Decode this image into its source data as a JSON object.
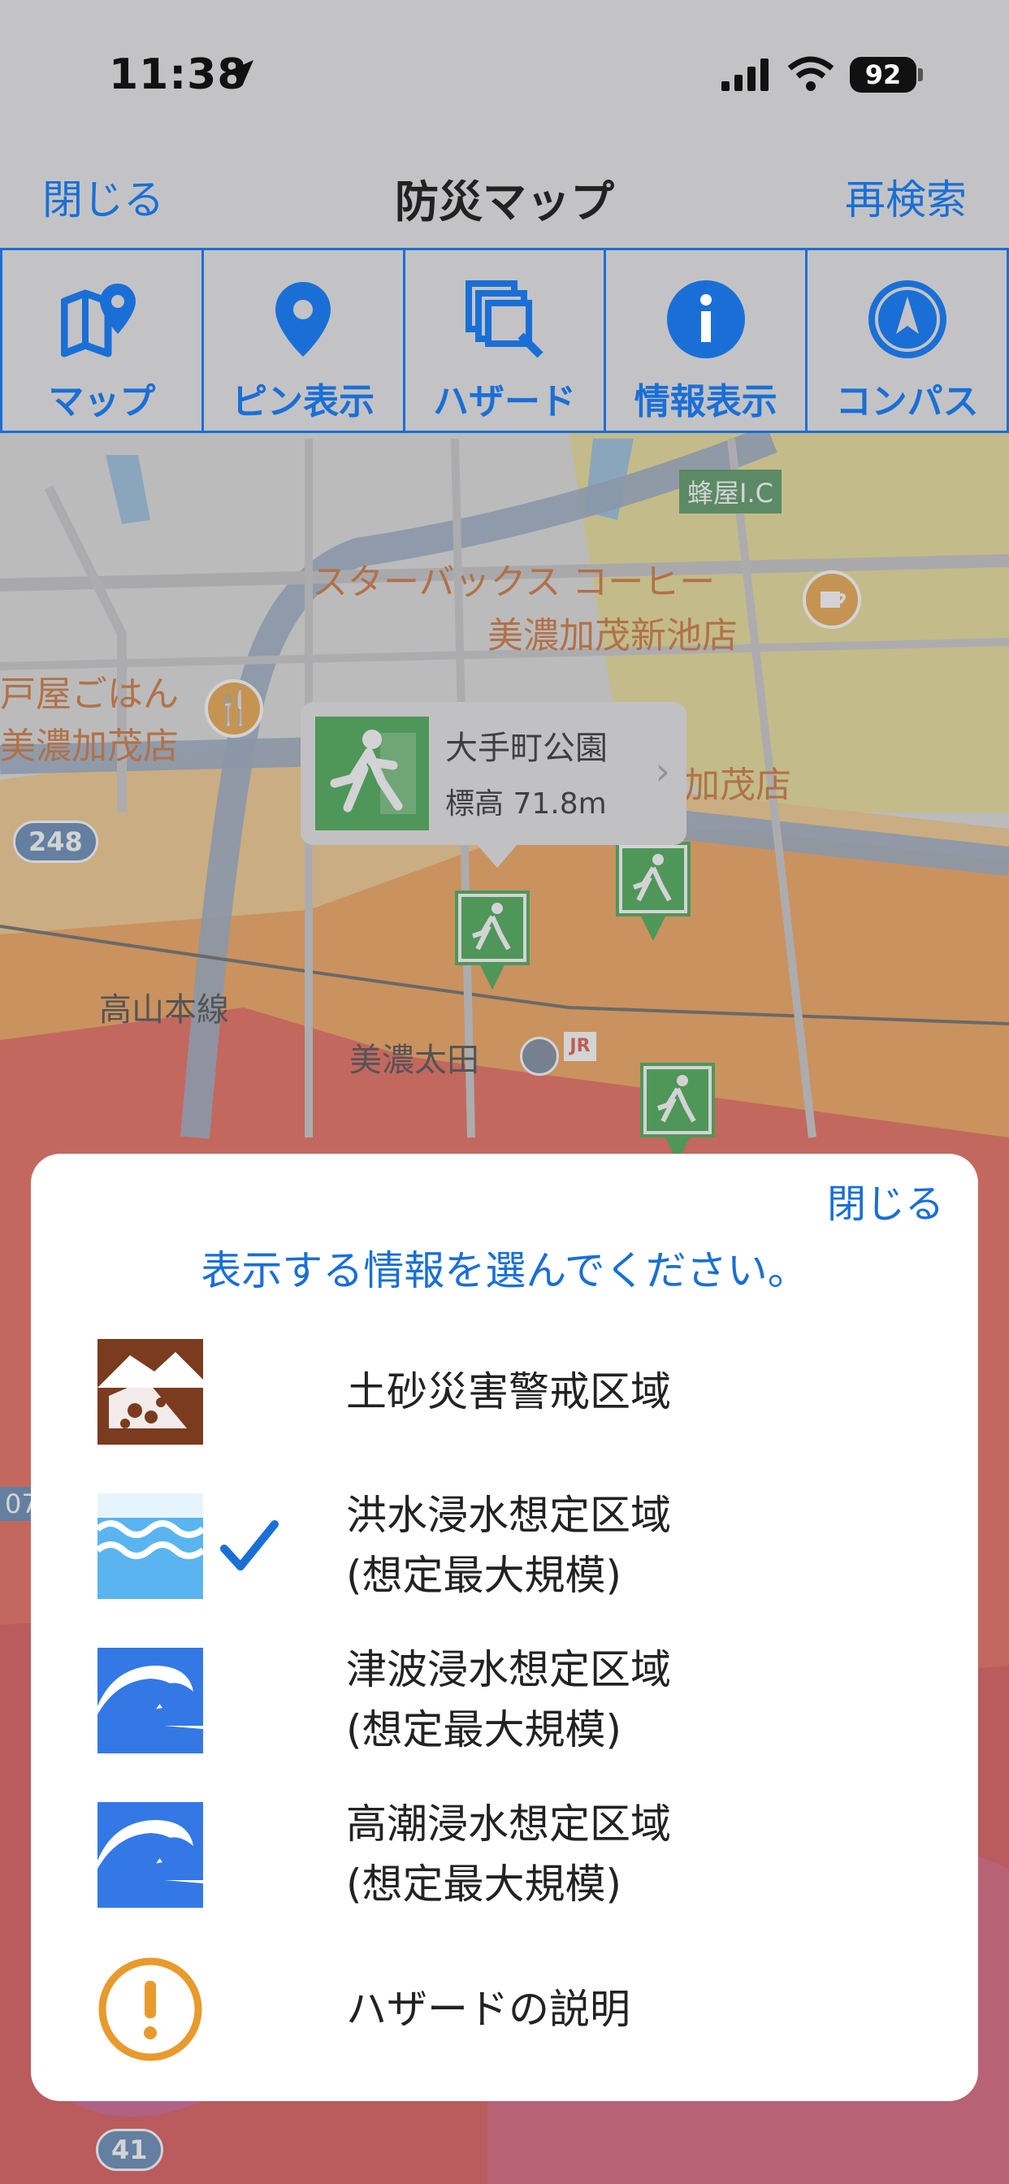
{
  "status_bar": {
    "time": "11:38",
    "battery": "92"
  },
  "nav": {
    "close_label": "閉じる",
    "title": "防災マップ",
    "research_label": "再検索"
  },
  "toolbar": {
    "items": [
      {
        "label": "マップ",
        "icon": "map-pin-icon"
      },
      {
        "label": "ピン表示",
        "icon": "location-pin-icon"
      },
      {
        "label": "ハザード",
        "icon": "hazard-layers-icon"
      },
      {
        "label": "情報表示",
        "icon": "info-icon"
      },
      {
        "label": "コンパス",
        "icon": "compass-icon"
      }
    ]
  },
  "map": {
    "labels": {
      "ic": "蜂屋I.C",
      "starbucks_1": "スターバックス コーヒー",
      "starbucks_2": "美濃加茂新池店",
      "restaurant_1": "戸屋ごはん",
      "restaurant_2": "美濃加茂店",
      "store_partial": "加茂店",
      "route_248": "248",
      "rail_line": "高山本線",
      "station": "美濃太田",
      "route_41": "41",
      "left_partial": "07"
    },
    "callout": {
      "name": "大手町公園",
      "elevation": "標高 71.8m"
    }
  },
  "sheet": {
    "close_label": "閉じる",
    "prompt": "表示する情報を選んでください。",
    "items": [
      {
        "icon": "landslide-icon",
        "line1": "土砂災害警戒区域",
        "line2": "",
        "checked": false
      },
      {
        "icon": "flood-icon",
        "line1": "洪水浸水想定区域",
        "line2": "(想定最大規模)",
        "checked": true
      },
      {
        "icon": "tsunami-icon",
        "line1": "津波浸水想定区域",
        "line2": "(想定最大規模)",
        "checked": false
      },
      {
        "icon": "storm-surge-icon",
        "line1": "高潮浸水想定区域",
        "line2": "(想定最大規模)",
        "checked": false
      },
      {
        "icon": "warning-icon",
        "line1": "ハザードの説明",
        "line2": "",
        "checked": false
      }
    ]
  },
  "colors": {
    "accent": "#1a6fd6",
    "evacuation_green": "#2a9d37",
    "landslide_brown": "#7a3b1e",
    "flood_light_blue": "#5ab4ef",
    "tsunami_blue": "#3478e6",
    "warning_orange": "#e89a2c"
  }
}
